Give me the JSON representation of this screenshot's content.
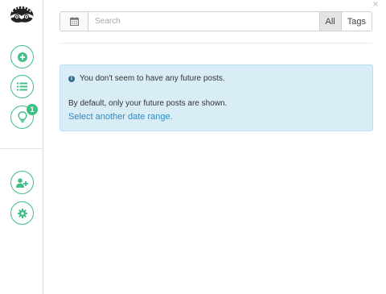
{
  "window": {
    "close_symbol": "×"
  },
  "sidebar": {
    "logo_icon": "raccoon-logo-icon",
    "buttons": [
      {
        "icon": "plus-icon"
      },
      {
        "icon": "list-icon"
      },
      {
        "icon": "lightbulb-icon",
        "badge": "1"
      },
      {
        "icon": "add-user-icon"
      },
      {
        "icon": "gear-icon"
      }
    ],
    "accent_color": "#3fbf86"
  },
  "search": {
    "calendar_icon": "calendar-icon",
    "placeholder": "Search",
    "value": "",
    "filters": [
      {
        "label": "All",
        "active": true
      },
      {
        "label": "Tags",
        "active": false
      }
    ]
  },
  "alert": {
    "icon": "info-icon",
    "icon_glyph": "i",
    "title": "You don't seem to have any future posts.",
    "description": "By default, only your future posts are shown.",
    "link_text": "Select another date range.",
    "background_color": "#d9edf7",
    "link_color": "#2f8abf"
  }
}
